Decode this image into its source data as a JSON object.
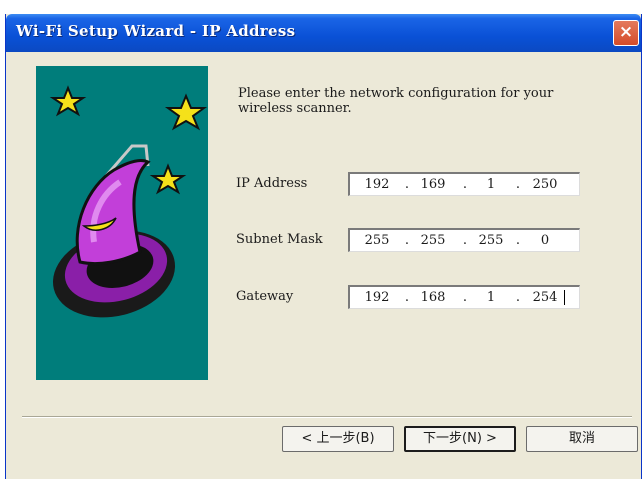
{
  "window": {
    "title": "Wi-Fi Setup Wizard - IP Address",
    "close_label": "×"
  },
  "prompt": "Please enter the network configuration for your wireless scanner.",
  "fields": [
    {
      "label": "IP Address",
      "octets": [
        "192",
        "169",
        "1",
        "250"
      ]
    },
    {
      "label": "Subnet Mask",
      "octets": [
        "255",
        "255",
        "255",
        "0"
      ]
    },
    {
      "label": "Gateway",
      "octets": [
        "192",
        "168",
        "1",
        "254"
      ]
    }
  ],
  "buttons": {
    "back": "< 上一步(B)",
    "next": "下一步(N) >",
    "cancel": "取消"
  }
}
